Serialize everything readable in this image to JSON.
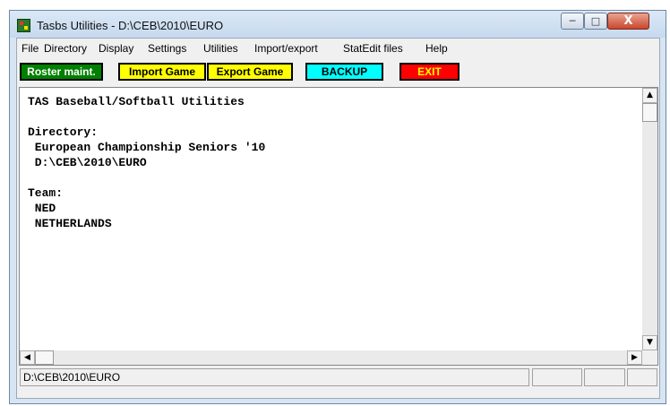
{
  "window": {
    "title": "Tasbs Utilities - D:\\CEB\\2010\\EURO"
  },
  "title_buttons": {
    "minimize": "─",
    "maximize": "□",
    "close": "X"
  },
  "menu": [
    "File",
    "Directory",
    "Display",
    "Settings",
    "Utilities",
    "Import/export",
    "StatEdit files",
    "Help"
  ],
  "toolbar": {
    "buttons": [
      {
        "label": "Roster maint.",
        "bg": "#008000",
        "fg": "#ffffff"
      },
      {
        "label": "Import Game",
        "bg": "#ffff00",
        "fg": "#000000"
      },
      {
        "label": "Export Game",
        "bg": "#ffff00",
        "fg": "#000000"
      },
      {
        "label": "BACKUP",
        "bg": "#00ffff",
        "fg": "#000000"
      },
      {
        "label": "EXIT",
        "bg": "#ff0000",
        "fg": "#ffff00"
      }
    ]
  },
  "content": {
    "lines": [
      "TAS Baseball/Softball Utilities",
      "",
      "Directory:",
      " European Championship Seniors '10",
      " D:\\CEB\\2010\\EURO",
      "",
      "Team:",
      " NED",
      " NETHERLANDS"
    ]
  },
  "scrollbar": {
    "up": "▲",
    "down": "▼",
    "left": "◀",
    "right": "▶"
  },
  "status": {
    "path": "D:\\CEB\\2010\\EURO",
    "panel2": "",
    "panel3": "",
    "panel4": ""
  }
}
